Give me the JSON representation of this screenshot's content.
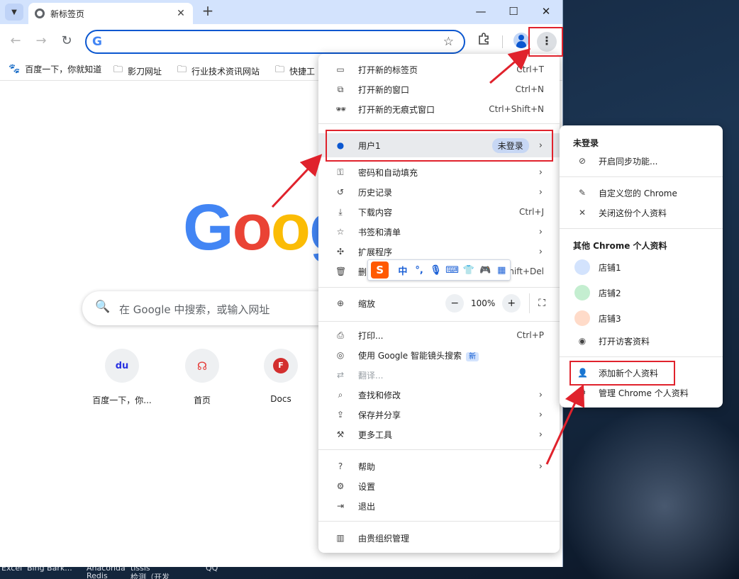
{
  "browser": {
    "tab_title": "新标签页",
    "new_tab_icon": "+",
    "win_min": "—",
    "win_max": "☐",
    "win_close": "✕"
  },
  "toolbar": {
    "back": "←",
    "forward": "→",
    "reload": "↻",
    "omnibox_logo": "G",
    "bookmark_star": "☆",
    "extensions_icon": "puzzle-icon"
  },
  "bookmarks": [
    {
      "label": "百度一下，你就知道",
      "icon": "paw-icon"
    },
    {
      "label": "影刀网址",
      "icon": "folder-icon"
    },
    {
      "label": "行业技术资讯网站",
      "icon": "folder-icon"
    },
    {
      "label": "快捷工",
      "icon": "folder-icon"
    }
  ],
  "ntp": {
    "logo_letters": [
      {
        "ch": "G",
        "color": "#4285f4"
      },
      {
        "ch": "o",
        "color": "#ea4335"
      },
      {
        "ch": "o",
        "color": "#fbbc05"
      },
      {
        "ch": "g",
        "color": "#4285f4"
      }
    ],
    "search_placeholder": "在 Google 中搜索，或输入网址",
    "shortcuts": [
      {
        "label": "百度一下，你...",
        "glyph": "du",
        "color": "#2932e1"
      },
      {
        "label": "首页",
        "glyph": "☊",
        "color": "#e53935"
      },
      {
        "label": "Docs",
        "glyph": "F",
        "color": "#d32f2f"
      }
    ]
  },
  "menu": {
    "new_tab": {
      "label": "打开新的标签页",
      "shortcut": "Ctrl+T"
    },
    "new_window": {
      "label": "打开新的窗口",
      "shortcut": "Ctrl+N"
    },
    "incognito": {
      "label": "打开新的无痕式窗口",
      "shortcut": "Ctrl+Shift+N"
    },
    "profile": {
      "label": "用户1",
      "badge": "未登录"
    },
    "passwords": {
      "label": "密码和自动填充"
    },
    "history": {
      "label": "历史记录"
    },
    "downloads": {
      "label": "下载内容",
      "shortcut": "Ctrl+J"
    },
    "bookmarks": {
      "label": "书签和清单"
    },
    "extensions": {
      "label": "扩展程序"
    },
    "clear": {
      "label": "删",
      "shortcut": "hift+Del"
    },
    "zoom": {
      "label": "缩放",
      "value": "100%",
      "minus": "−",
      "plus": "+"
    },
    "print": {
      "label": "打印...",
      "shortcut": "Ctrl+P"
    },
    "lens": {
      "label": "使用 Google 智能镜头搜索",
      "badge": "新"
    },
    "translate": {
      "label": "翻译..."
    },
    "find": {
      "label": "查找和修改"
    },
    "save_share": {
      "label": "保存并分享"
    },
    "more_tools": {
      "label": "更多工具"
    },
    "help": {
      "label": "帮助"
    },
    "settings": {
      "label": "设置"
    },
    "exit": {
      "label": "退出"
    },
    "managed": {
      "label": "由贵组织管理"
    }
  },
  "ime": {
    "logo": "S",
    "items": [
      "中",
      "°,",
      "🎙",
      "⌨",
      "👕",
      "🎮",
      "▦"
    ]
  },
  "profile_submenu": {
    "status_header": "未登录",
    "sync": "开启同步功能...",
    "customize": "自定义您的 Chrome",
    "close_profile": "关闭这份个人资料",
    "others_header": "其他 Chrome 个人资料",
    "profiles": [
      {
        "name": "店铺1",
        "bg": "#d3e3fd",
        "fg": "#0b57d0"
      },
      {
        "name": "店铺2",
        "bg": "#c4eed0",
        "fg": "#146c2e"
      },
      {
        "name": "店铺3",
        "bg": "#ffdbc9",
        "fg": "#b3541e"
      }
    ],
    "guest": "打开访客资料",
    "add": "添加新个人资料",
    "manage": "管理 Chrome 个人资料"
  },
  "desktop_labels": [
    "Excel",
    "Bing Bark...",
    "Anaconda",
    "Redis",
    "tissis",
    "检测（开发",
    "QQ"
  ]
}
